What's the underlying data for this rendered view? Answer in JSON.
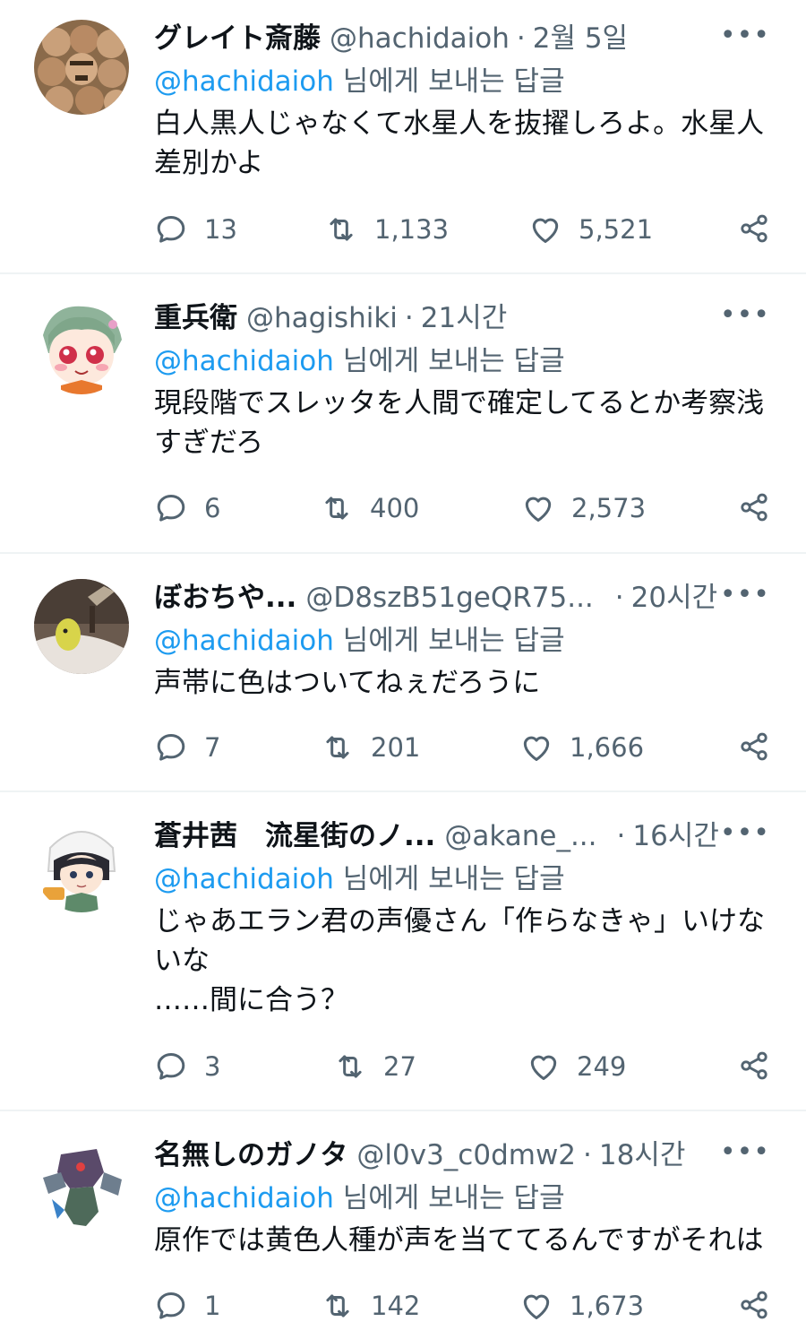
{
  "tweets": [
    {
      "name": "グレイト斎藤",
      "handle": "@hachidaioh",
      "time": "2월 5일",
      "reply_to": "@hachidaioh",
      "reply_suffix": "님에게 보내는 답글",
      "text": "白人黒人じゃなくて水星人を抜擢しろよ。水星人\n差別かよ",
      "replies": "13",
      "retweets": "1,133",
      "likes": "5,521"
    },
    {
      "name": "重兵衛",
      "handle": "@hagishiki",
      "time": "21시간",
      "reply_to": "@hachidaioh",
      "reply_suffix": "님에게 보내는 답글",
      "text": "現段階でスレッタを人間で確定してるとか考察浅\nすぎだろ",
      "replies": "6",
      "retweets": "400",
      "likes": "2,573"
    },
    {
      "name": "ぼおちや...",
      "handle": "@D8szB51geQR75...",
      "time": "20시간",
      "reply_to": "@hachidaioh",
      "reply_suffix": "님에게 보내는 답글",
      "text": "声帯に色はついてねぇだろうに",
      "replies": "7",
      "retweets": "201",
      "likes": "1,666"
    },
    {
      "name": "蒼井茜　流星街のノ...",
      "handle": "@akane_...",
      "time": "16시간",
      "reply_to": "@hachidaioh",
      "reply_suffix": "님에게 보내는 답글",
      "text": "じゃあエラン君の声優さん「作らなきゃ」いけな\nいな\n……間に合う？",
      "replies": "3",
      "retweets": "27",
      "likes": "249"
    },
    {
      "name": "名無しのガノタ",
      "handle": "@l0v3_c0dmw2",
      "time": "18시간",
      "reply_to": "@hachidaioh",
      "reply_suffix": "님에게 보내는 답글",
      "text": "原作では黄色人種が声を当ててるんですがそれは",
      "replies": "1",
      "retweets": "142",
      "likes": "1,673"
    }
  ],
  "ui": {
    "more_glyph": "•••",
    "dot": "·"
  },
  "icons": {
    "reply": "reply-icon",
    "retweet": "retweet-icon",
    "like": "heart-icon",
    "share": "share-icon",
    "more": "more-icon"
  },
  "colors": {
    "link": "#1d9bf0",
    "secondary": "#536471",
    "text": "#0f1419",
    "divider": "#eff3f4"
  }
}
